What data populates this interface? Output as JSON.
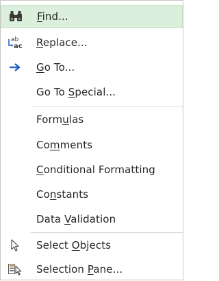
{
  "menu": {
    "items": [
      {
        "pre": "",
        "ul": "F",
        "post": "ind...",
        "icon": "binoculars-icon"
      },
      {
        "pre": "",
        "ul": "R",
        "post": "eplace...",
        "icon": "replace-icon"
      },
      {
        "pre": "",
        "ul": "G",
        "post": "o To...",
        "icon": "arrow-right-icon"
      },
      {
        "pre": "Go To ",
        "ul": "S",
        "post": "pecial...",
        "icon": ""
      },
      {
        "pre": "Form",
        "ul": "u",
        "post": "las",
        "icon": ""
      },
      {
        "pre": "Co",
        "ul": "m",
        "post": "ments",
        "icon": ""
      },
      {
        "pre": "",
        "ul": "C",
        "post": "onditional Formatting",
        "icon": ""
      },
      {
        "pre": "Co",
        "ul": "n",
        "post": "stants",
        "icon": ""
      },
      {
        "pre": "Data ",
        "ul": "V",
        "post": "alidation",
        "icon": ""
      },
      {
        "pre": "Select ",
        "ul": "O",
        "post": "bjects",
        "icon": "select-objects-icon"
      },
      {
        "pre": "Selection ",
        "ul": "P",
        "post": "ane...",
        "icon": "selection-pane-icon"
      }
    ],
    "colors": {
      "highlight": "#dcefdc",
      "arrow": "#1f5fbf",
      "text": "#262626"
    }
  }
}
